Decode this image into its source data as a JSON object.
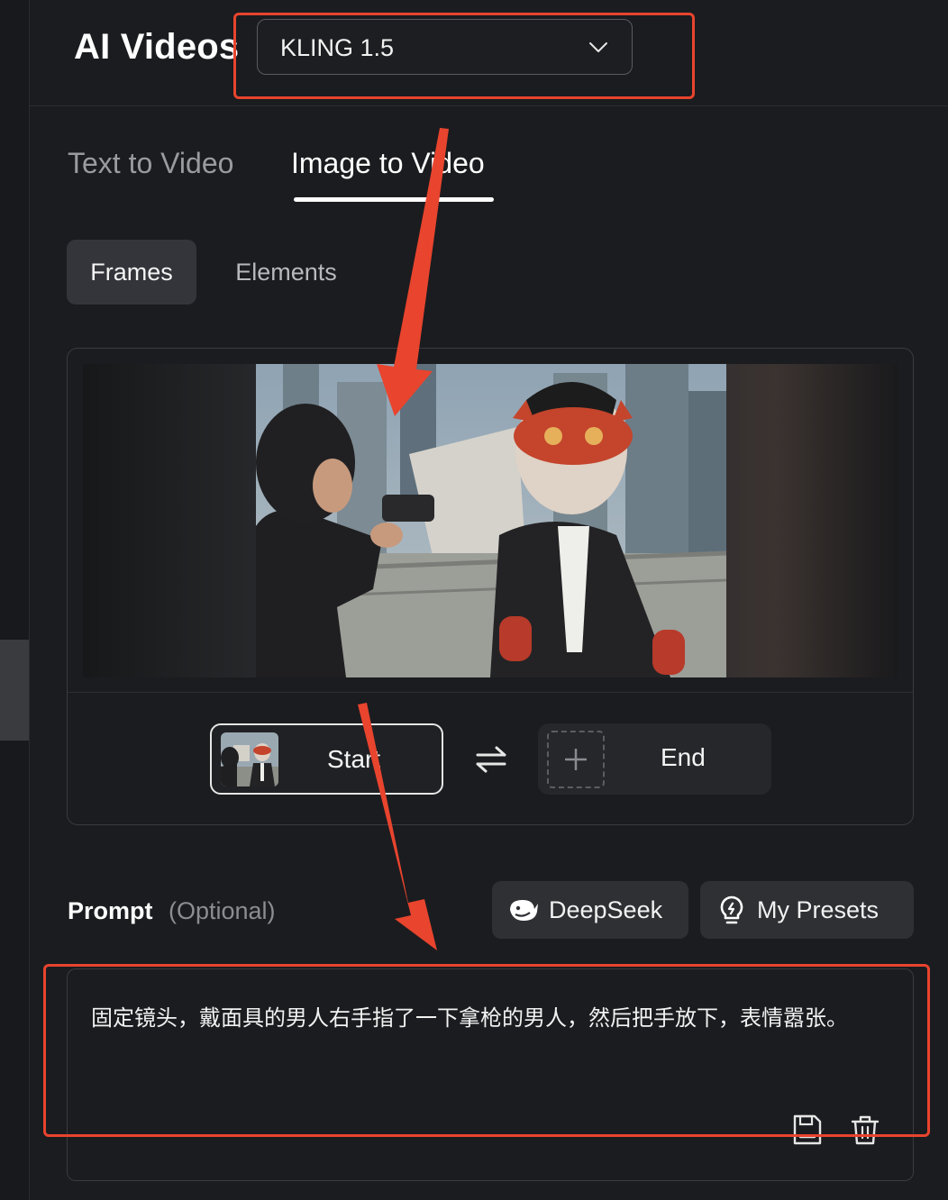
{
  "header": {
    "title": "AI Videos",
    "model_select": {
      "value": "KLING 1.5",
      "icon": "chevron-down-icon"
    }
  },
  "tabs": [
    {
      "label": "Text to Video",
      "active": false
    },
    {
      "label": "Image to Video",
      "active": true
    }
  ],
  "subtabs": [
    {
      "label": "Frames",
      "active": true
    },
    {
      "label": "Elements",
      "active": false
    }
  ],
  "frames": {
    "start_label": "Start",
    "end_label": "End",
    "swap_icon": "swap-arrows-icon",
    "add_icon": "plus-icon"
  },
  "prompt": {
    "label": "Prompt",
    "optional": "(Optional)",
    "deepseek_label": "DeepSeek",
    "presets_label": "My Presets",
    "text": "固定镜头，戴面具的男人右手指了一下拿枪的男人，然后把手放下，表情嚣张。",
    "save_icon": "save-icon",
    "delete_icon": "trash-icon"
  },
  "colors": {
    "background": "#1b1c1f",
    "annotation": "#e8442e",
    "text": "#ffffff",
    "muted": "#9a9b9f"
  }
}
